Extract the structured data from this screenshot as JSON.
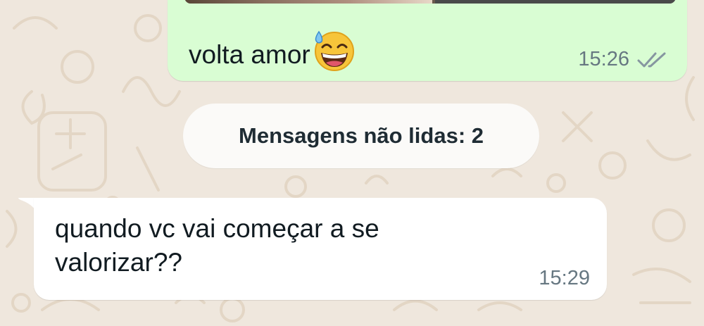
{
  "outgoing_message": {
    "text": "volta amor",
    "emoji": "grinning-face-with-sweat",
    "time": "15:26",
    "status": "delivered"
  },
  "unread_divider": {
    "label": "Mensagens não lidas: 2"
  },
  "incoming_message": {
    "text": "quando vc vai começar a se valorizar??",
    "time": "15:29"
  },
  "colors": {
    "wallpaper": "#efe7dd",
    "outgoing_bubble": "#d9fdd3",
    "incoming_bubble": "#ffffff",
    "timestamp": "#667781",
    "tick": "#8696a0"
  }
}
